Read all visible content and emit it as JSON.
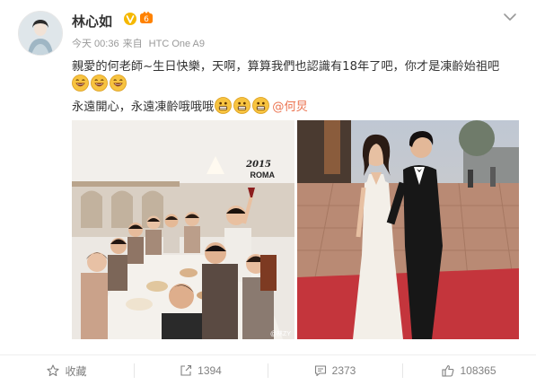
{
  "post": {
    "username": "林心如",
    "meta": {
      "time": "今天 00:36",
      "source_prefix": "来自",
      "device": "HTC One A9"
    },
    "text_line1": "親愛的何老師~生日快樂，天啊，算算我們也認識有18年了吧，你才是凍齡始祖吧",
    "text_line2": "永遠開心，永遠凍齡哦哦哦",
    "mention": "@何炅",
    "emoji_line1": [
      "laugh-emoji",
      "laugh-emoji",
      "laugh-emoji"
    ],
    "emoji_line2": [
      "grin-emoji",
      "grin-emoji",
      "grin-emoji"
    ],
    "photo_left": {
      "overlay_year": "2015",
      "overlay_place": "ROMA",
      "watermark": "@林ZY"
    }
  },
  "actions": [
    {
      "label": "收藏",
      "icon": "star-icon"
    },
    {
      "label": "1394",
      "icon": "repost-icon"
    },
    {
      "label": "2373",
      "icon": "comment-icon"
    },
    {
      "label": "108365",
      "icon": "like-icon"
    }
  ],
  "colors": {
    "text": "#333333",
    "meta": "#999999",
    "mention": "#eb7350",
    "verified": "#f5b800",
    "action": "#808080"
  }
}
